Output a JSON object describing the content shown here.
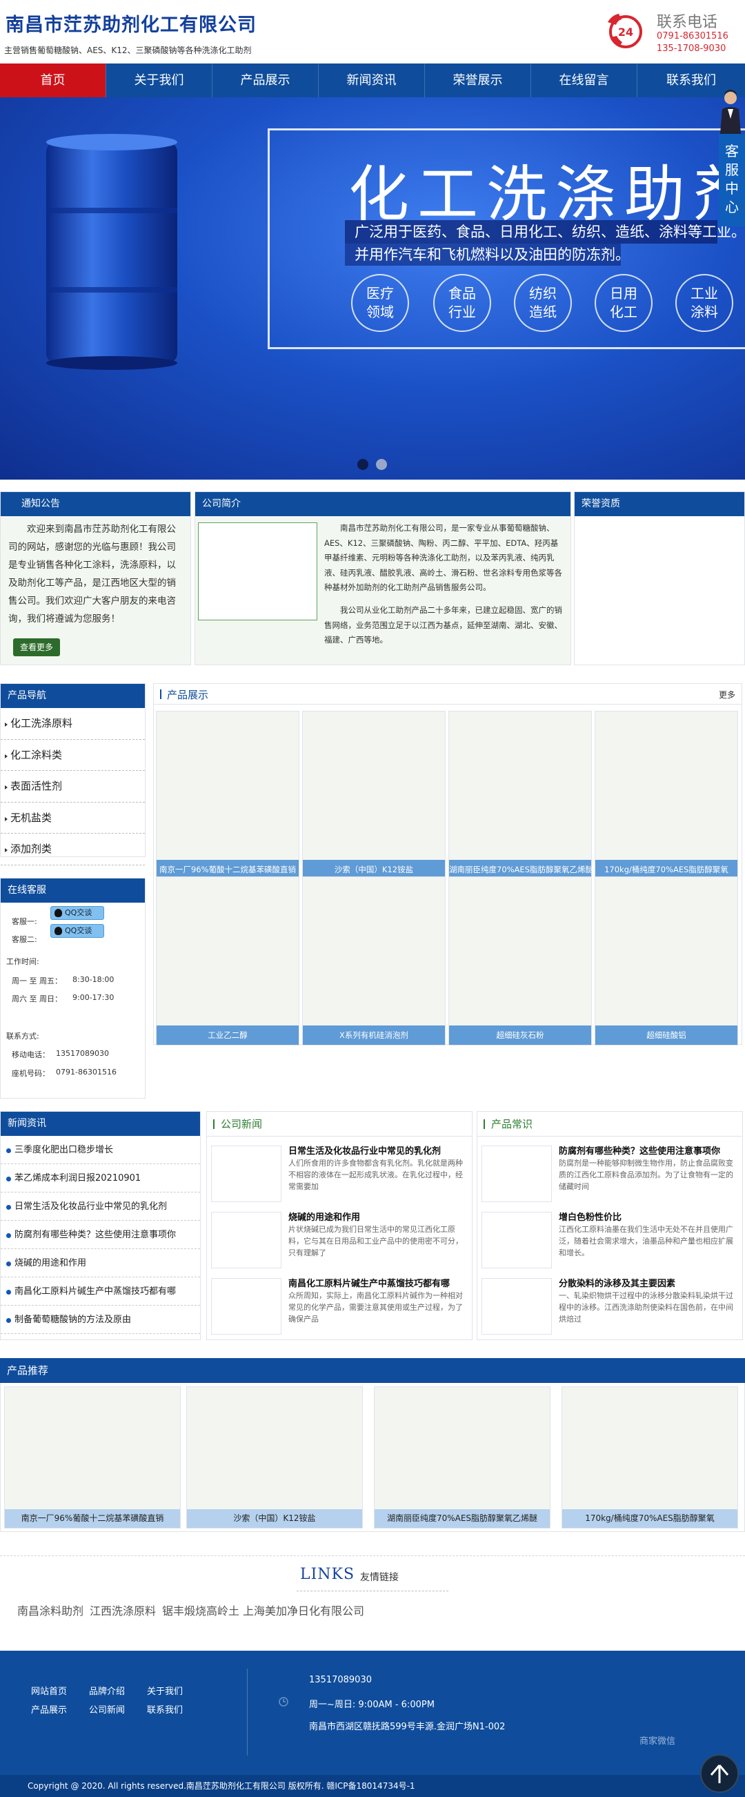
{
  "header": {
    "title": "南昌市茳苏助剂化工有限公司",
    "subtitle": "主营销售葡萄糖酸钠、AES、K12、三聚磷酸钠等各种洗涤化工助剂",
    "phone_label": "联系电话",
    "phones": [
      "0791-86301516",
      "135-1708-9030"
    ],
    "phone_badge": "24"
  },
  "nav": {
    "items": [
      "首页",
      "关于我们",
      "产品展示",
      "新闻资讯",
      "荣誉展示",
      "在线留言",
      "联系我们"
    ],
    "active": "首页"
  },
  "banner": {
    "title": "化工洗涤助剂",
    "line1": "广泛用于医药、食品、日用化工、纺织、造纸、涂料等工业。",
    "line2": "并用作汽车和飞机燃料以及油田的防冻剂。",
    "circles": [
      "医疗\n领域",
      "食品\n行业",
      "纺织\n造纸",
      "日用\n化工",
      "工业\n涂料"
    ]
  },
  "float_service": {
    "label": "客服中心"
  },
  "notice": {
    "title": "通知公告",
    "text": "欢迎来到南昌市茳苏助剂化工有限公司的网站，感谢您的光临与惠顾！我公司是专业销售各种化工涂料，洗涤原料，以及助剂化工等产品，是江西地区大型的销售公司。我们欢迎广大客户朋友的来电咨询，我们将遵诚为您服务！",
    "more": "查看更多"
  },
  "intro": {
    "title": "公司简介",
    "p1": "南昌市茳苏助剂化工有限公司，是一家专业从事葡萄糖酸钠、AES、K12、三聚磷酸钠、陶粉、丙二醇、平平加、EDTA、羟丙基甲基纤维素、元明粉等各种洗涤化工助剂，以及苯丙乳液、纯丙乳液、硅丙乳液、醋胶乳液、高岭土、滑石粉、世名涂料专用色浆等各种基材外加助剂的化工助剂产品销售服务公司。",
    "p2": "我公司从业化工助剂产品二十多年来，已建立起稳固、宽广的销售网络，业务范围立足于以江西为基点，延伸至湖南、湖北、安徽、福建、广西等地。"
  },
  "honor": {
    "title": "荣誉资质"
  },
  "product_nav": {
    "title": "产品导航",
    "items": [
      "化工洗涤原料",
      "化工涂料类",
      "表面活性剂",
      "无机盐类",
      "添加剂类"
    ]
  },
  "online": {
    "title": "在线客服",
    "agents": [
      "客服一:",
      "客服二:"
    ],
    "qq_label": "QQ交谈",
    "work_time_label": "工作时间:",
    "weekday_label": "周一 至 周五：",
    "weekday_time": "8:30-18:00",
    "weekend_label": "周六 至 周日：",
    "weekend_time": "9:00-17:30",
    "contact_label": "联系方式:",
    "mobile_label": "移动电话：",
    "mobile": "13517089030",
    "landline_label": "座机号码：",
    "landline": "0791-86301516"
  },
  "products": {
    "title": "产品展示",
    "more": "更多",
    "items": [
      "南京一厂96%葡酸十二烷基苯磺酸直销",
      "沙索（中国）K12铵盐",
      "湖南丽臣纯度70%AES脂肪醇聚氧乙烯醚",
      "170kg/桶纯度70%AES脂肪醇聚氧",
      "工业乙二醇",
      "X系列有机硅消泡剂",
      "超细硅灰石粉",
      "超细硅酸铝"
    ]
  },
  "news": {
    "title": "新闻资讯",
    "items": [
      "三季度化肥出口稳步增长",
      "苯乙烯成本利润日报20210901",
      "日常生活及化妆品行业中常见的乳化剂",
      "防腐剂有哪些种类？这些使用注意事项你",
      "烧碱的用途和作用",
      "南昌化工原料片碱生产中蒸馏技巧都有哪",
      "制备葡萄糖酸钠的方法及原由"
    ]
  },
  "company_news": {
    "title": "公司新闻",
    "articles": [
      {
        "title": "日常生活及化妆品行业中常见的乳化剂",
        "desc": "人们所食用的许多食物都含有乳化剂。乳化就是两种不相容的液体在一起形成乳状液。在乳化过程中，经常需要加"
      },
      {
        "title": "烧碱的用途和作用",
        "desc": "片状烧碱已成为我们日常生活中的常见江西化工原料，它与其在日用品和工业产品中的使用密不可分，只有理解了"
      },
      {
        "title": "南昌化工原料片碱生产中蒸馏技巧都有哪",
        "desc": "众所周知，实际上，南昌化工原料片碱作为一种相对常见的化学产品，需要注意其使用或生产过程，为了确保产品"
      }
    ]
  },
  "knowledge": {
    "title": "产品常识",
    "articles": [
      {
        "title": "防腐剂有哪些种类？这些使用注意事项你",
        "desc": "防腐剂是一种能够抑制微生物作用，防止食品腐败变质的江西化工原料食品添加剂。为了让食物有一定的储藏时间"
      },
      {
        "title": "增白色粉性价比",
        "desc": "江西化工原料油墨在我们生活中无处不在并且使用广泛，随着社会需求增大，油墨品种和产量也相应扩展和增长。"
      },
      {
        "title": "分散染料的泳移及其主要因素",
        "desc": "一、轧染织物烘干过程中的泳移分散染料轧染烘干过程中的泳移。江西洗涤助剂使染料在国色前，在中间烘焙过"
      }
    ]
  },
  "recommended": {
    "title": "产品推荐",
    "items": [
      "南京一厂96%葡酸十二烷基苯磺酸直销",
      "沙索（中国）K12铵盐",
      "湖南丽臣纯度70%AES脂肪醇聚氧乙烯醚",
      "170kg/桶纯度70%AES脂肪醇聚氧"
    ]
  },
  "links": {
    "title": "LINKS",
    "subtitle": "友情链接",
    "items": [
      "南昌涂料助剂",
      "江西洗涤原料",
      "锯丰煅烧高岭土",
      "上海美加净日化有限公司"
    ]
  },
  "footer": {
    "links": [
      "网站首页",
      "品牌介绍",
      "关于我们",
      "产品展示",
      "公司新闻",
      "联系我们"
    ],
    "phone": "13517089030",
    "hours": "周一~周日: 9:00AM - 6:00PM",
    "address": "南昌市西湖区赣抚路599号丰源.金润广场N1-002",
    "wechat": "商家微信",
    "copyright": "Copyright @ 2020. All rights reserved.南昌茳苏助剂化工有限公司 版权所有. 赣ICP备18014734号-1"
  },
  "colors": {
    "nav_blue": "#0f4d9c",
    "active_red": "#cc1218",
    "phone_red": "#d8262e",
    "title_blue": "#123f9c"
  }
}
